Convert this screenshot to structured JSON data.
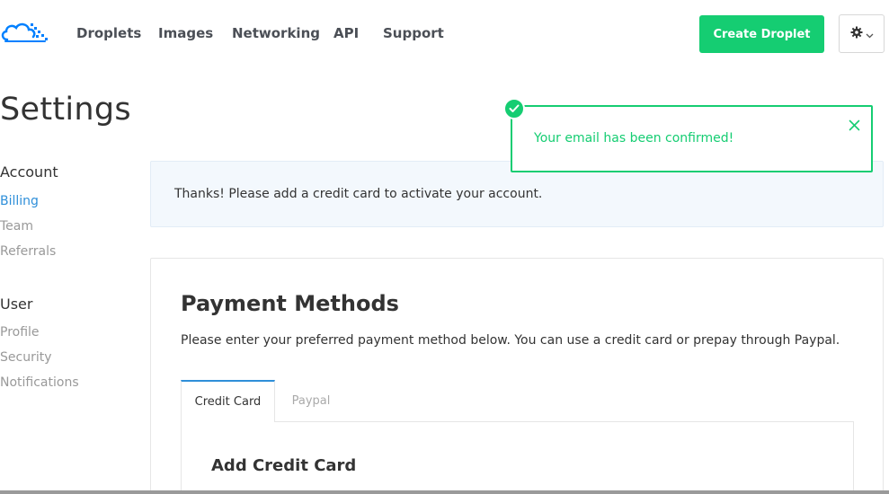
{
  "nav": {
    "logo_icon": "cloud-logo-icon",
    "links": [
      "Droplets",
      "Images",
      "Networking",
      "API",
      "Support"
    ],
    "create_button": "Create Droplet",
    "settings_icon": "gear-icon",
    "brand_color": "#15cd72"
  },
  "page": {
    "title": "Settings"
  },
  "sidebar": {
    "sections": [
      {
        "heading": "Account",
        "items": [
          "Billing",
          "Team",
          "Referrals"
        ],
        "active": "Billing"
      },
      {
        "heading": "User",
        "items": [
          "Profile",
          "Security",
          "Notifications"
        ]
      }
    ]
  },
  "banner": {
    "text": "Thanks! Please add a credit card to activate your account."
  },
  "toast": {
    "message": "Your email has been confirmed!",
    "status_icon": "check-icon",
    "close_icon": "close-icon"
  },
  "payment": {
    "title": "Payment Methods",
    "description": "Please enter your preferred payment method below. You can use a credit card or prepay through Paypal.",
    "tabs": [
      "Credit Card",
      "Paypal"
    ],
    "active_tab": "Credit Card",
    "panel_heading": "Add Credit Card"
  }
}
